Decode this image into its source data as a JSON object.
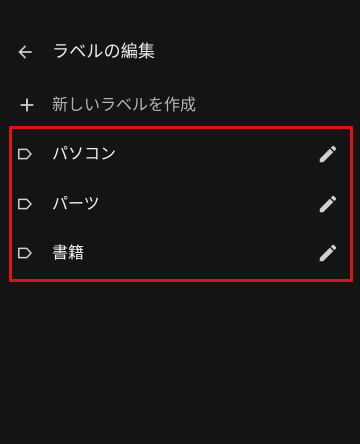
{
  "header": {
    "back_icon": "arrow-left-icon",
    "title": "ラベルの編集"
  },
  "new_label": {
    "icon": "plus-icon",
    "placeholder": "新しいラベルを作成"
  },
  "labels": [
    {
      "name": "パソコン",
      "icon": "label-tag-icon",
      "edit_icon": "pencil-icon"
    },
    {
      "name": "パーツ",
      "icon": "label-tag-icon",
      "edit_icon": "pencil-icon"
    },
    {
      "name": "書籍",
      "icon": "label-tag-icon",
      "edit_icon": "pencil-icon"
    }
  ],
  "colors": {
    "background": "#141414",
    "text": "#ececec",
    "muted_text": "#b3b3b3",
    "icon": "#cfcfcf",
    "highlight": "#e01218"
  }
}
